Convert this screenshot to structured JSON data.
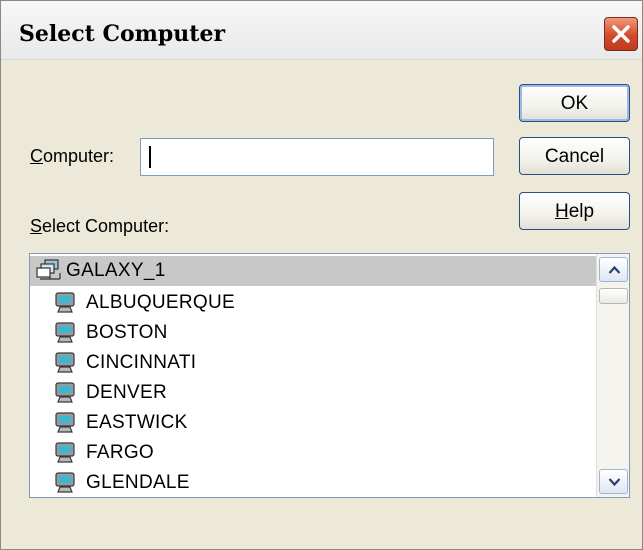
{
  "dialog": {
    "title": "Select Computer",
    "close_icon": "close-icon"
  },
  "form": {
    "computer_label_first": "C",
    "computer_label_rest": "omputer:",
    "computer_value": "",
    "select_label_first": "S",
    "select_label_rest": "elect Computer:"
  },
  "buttons": {
    "ok": "OK",
    "cancel": "Cancel",
    "help_first": "H",
    "help_rest": "elp"
  },
  "computer_list": {
    "domain": "GALAXY_1",
    "items": [
      "ALBUQUERQUE",
      "BOSTON",
      "CINCINNATI",
      "DENVER",
      "EASTWICK",
      "FARGO",
      "GLENDALE"
    ]
  },
  "scrollbar": {
    "up_icon": "chevron-up-icon",
    "down_icon": "chevron-down-icon"
  },
  "colors": {
    "close_button": "#d24a2a",
    "selection": "#c8c8c8",
    "icon_screen": "#39b8d6"
  }
}
